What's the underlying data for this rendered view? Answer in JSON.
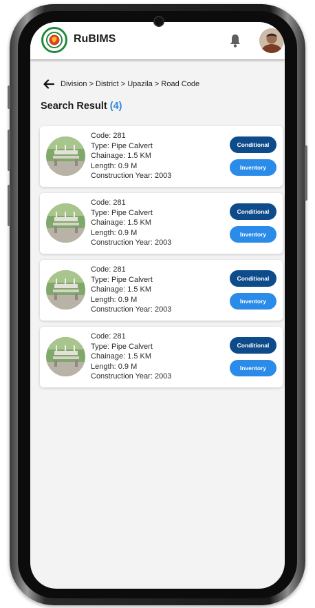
{
  "app": {
    "title": "RuBIMS",
    "logo_icon": "bangladesh-emblem-icon",
    "notification_icon": "bell-icon"
  },
  "nav": {
    "back_icon": "arrow-left-icon",
    "breadcrumb": "Division > District > Upazila > Road Code"
  },
  "results": {
    "heading": "Search Result",
    "count": "(4)",
    "items": [
      {
        "code": "Code: 281",
        "type": "Type: Pipe Calvert",
        "chainage": "Chainage: 1.5 KM",
        "length": "Length: 0.9 M",
        "year": "Construction Year: 2003",
        "conditional_label": "Conditional",
        "inventory_label": "Inventory"
      },
      {
        "code": "Code: 281",
        "type": "Type: Pipe Calvert",
        "chainage": "Chainage: 1.5 KM",
        "length": "Length: 0.9 M",
        "year": "Construction Year: 2003",
        "conditional_label": "Conditional",
        "inventory_label": "Inventory"
      },
      {
        "code": "Code: 281",
        "type": "Type: Pipe Calvert",
        "chainage": "Chainage: 1.5 KM",
        "length": "Length: 0.9 M",
        "year": "Construction Year: 2003",
        "conditional_label": "Conditional",
        "inventory_label": "Inventory"
      },
      {
        "code": "Code: 281",
        "type": "Type: Pipe Calvert",
        "chainage": "Chainage: 1.5 KM",
        "length": "Length: 0.9 M",
        "year": "Construction Year: 2003",
        "conditional_label": "Conditional",
        "inventory_label": "Inventory"
      }
    ]
  },
  "colors": {
    "primary_dark": "#0e4b8a",
    "primary": "#2a8be8",
    "count_accent": "#2f86e0",
    "emblem_green": "#1f8a3c",
    "emblem_red": "#e23b2e"
  }
}
